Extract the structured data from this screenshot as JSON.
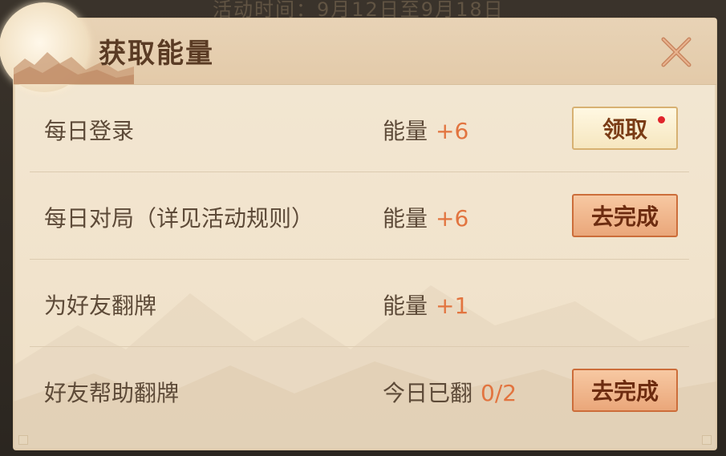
{
  "background": {
    "top_text": "活动时间：9月12日至9月18日"
  },
  "dialog": {
    "title": "获取能量",
    "close_icon": "close-x-icon",
    "colors": {
      "accent_value": "#e2743f",
      "text": "#5d4a38",
      "claim_button_bg": "#f6e6bf",
      "go_button_bg": "#eaa77a",
      "notification_dot": "#e0242b"
    },
    "rows": [
      {
        "label": "每日登录",
        "reward_label": "能量",
        "reward_value": "+6",
        "button_label": "领取",
        "button_type": "claim",
        "has_dot": true
      },
      {
        "label": "每日对局（详见活动规则）",
        "reward_label": "能量",
        "reward_value": "+6",
        "button_label": "去完成",
        "button_type": "go",
        "has_dot": false
      },
      {
        "label": "为好友翻牌",
        "reward_label": "能量",
        "reward_value": "+1",
        "button_label": "",
        "button_type": "none",
        "has_dot": false
      },
      {
        "label": "好友帮助翻牌",
        "reward_label": "今日已翻",
        "reward_value": "0/2",
        "button_label": "去完成",
        "button_type": "go",
        "has_dot": false
      }
    ]
  }
}
